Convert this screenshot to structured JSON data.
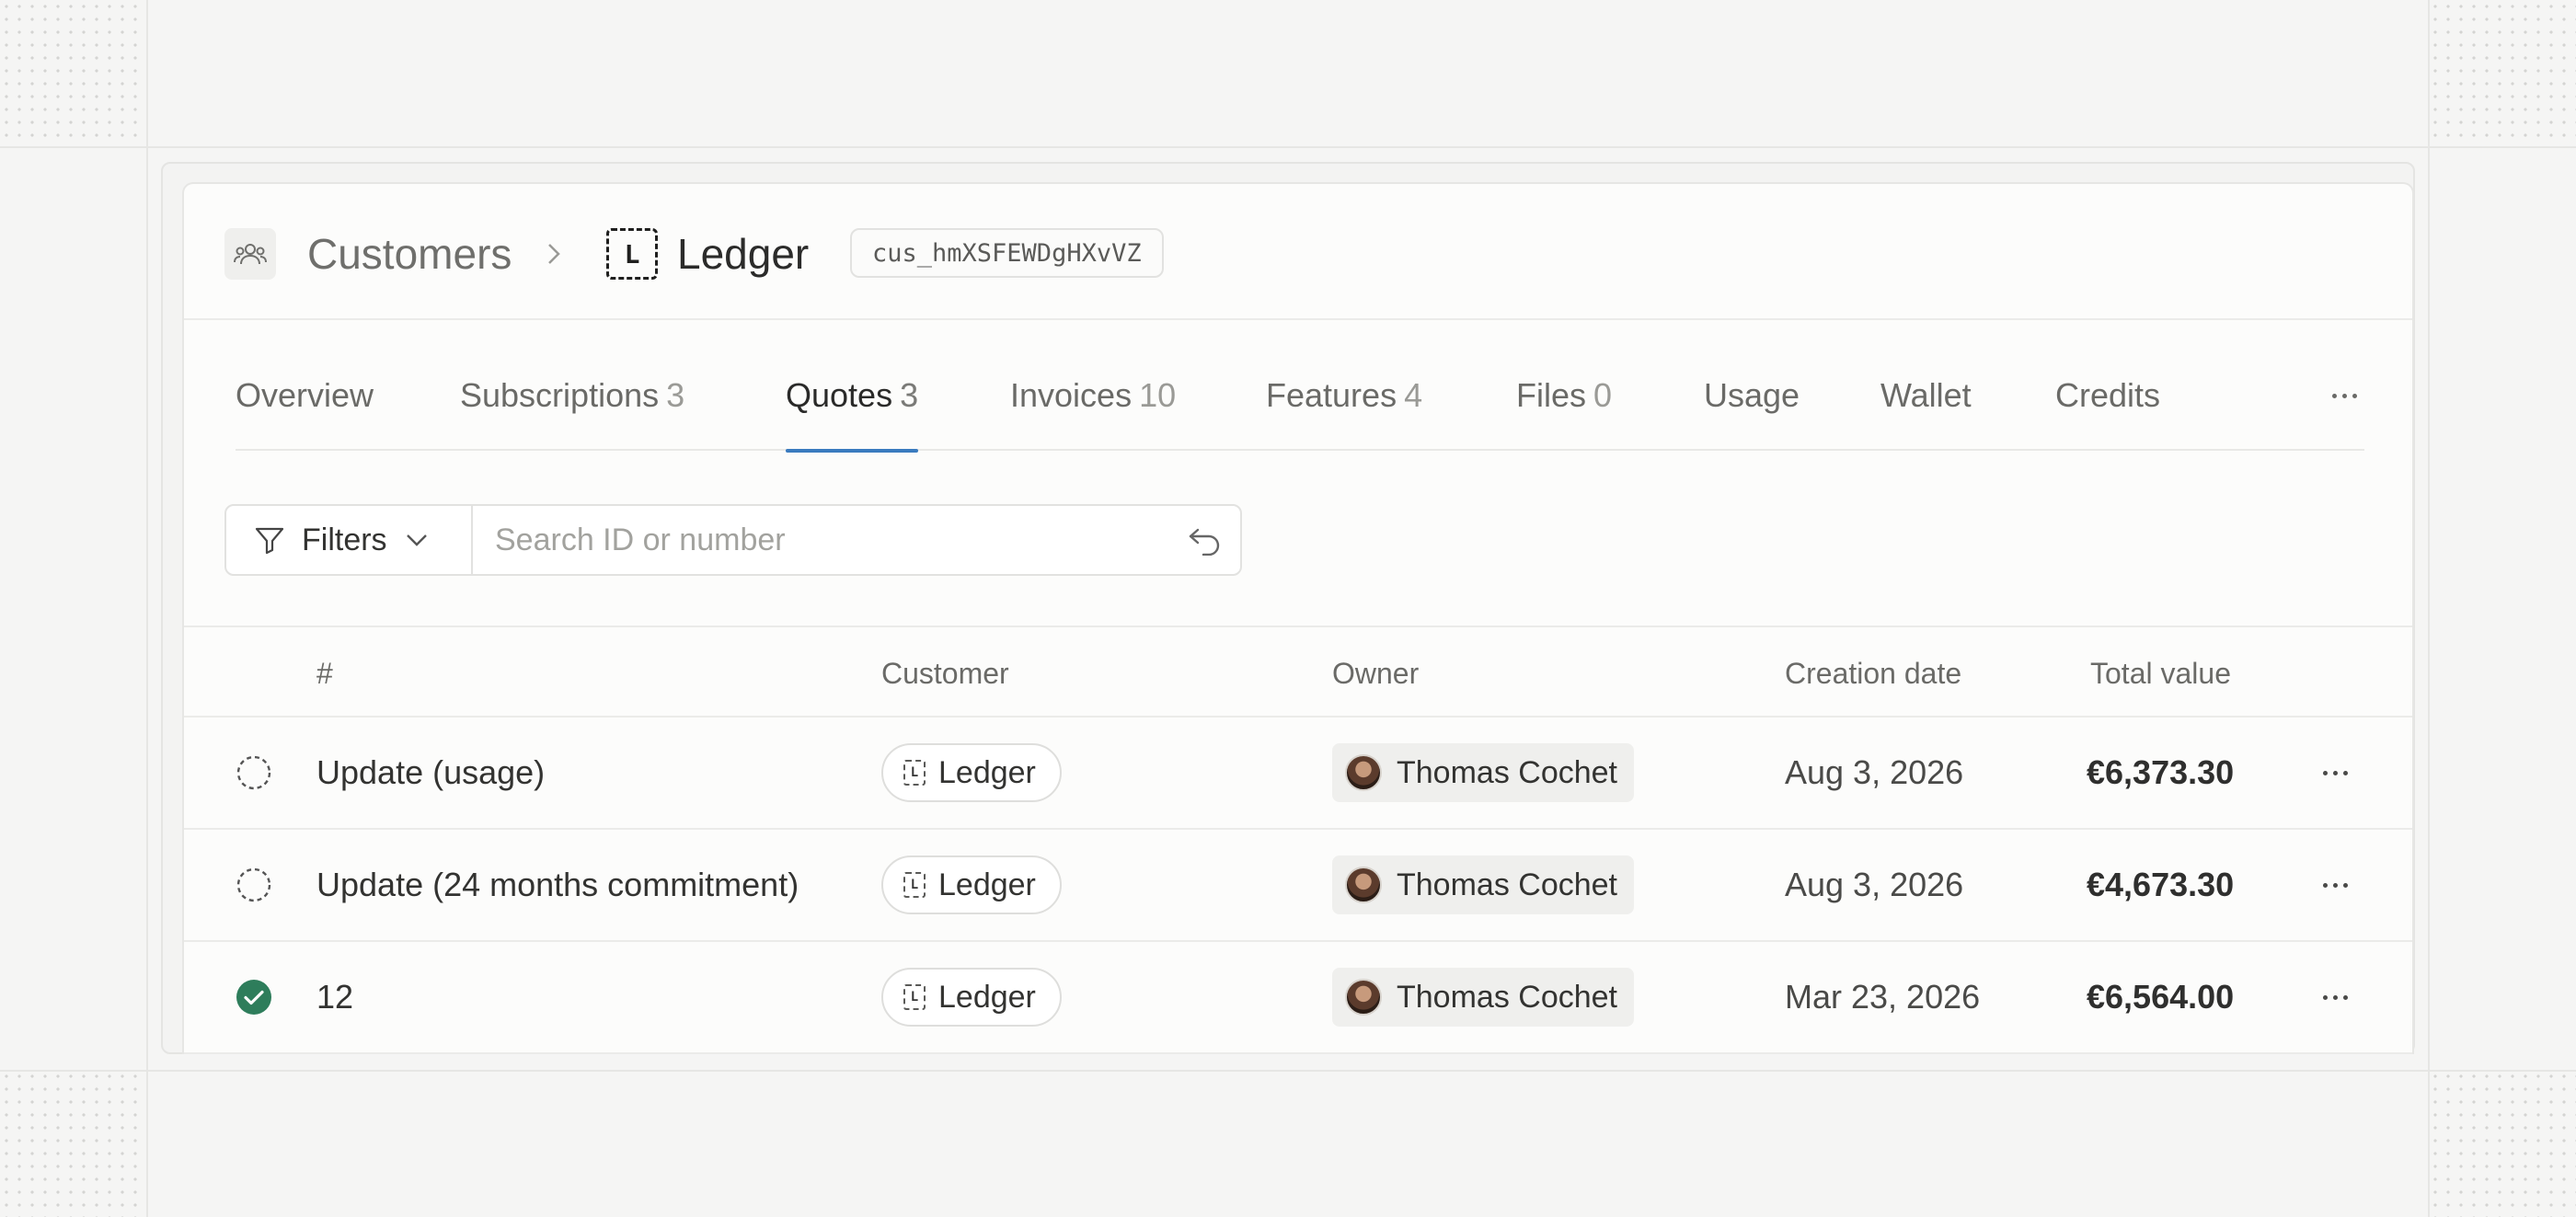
{
  "breadcrumb": {
    "root": "Customers",
    "current": "Ledger",
    "logo_letter": "L",
    "customer_id": "cus_hmXSFEWDgHXvVZ"
  },
  "tabs": [
    {
      "label": "Overview",
      "count": ""
    },
    {
      "label": "Subscriptions",
      "count": "3"
    },
    {
      "label": "Quotes",
      "count": "3",
      "active": true
    },
    {
      "label": "Invoices",
      "count": "10"
    },
    {
      "label": "Features",
      "count": "4"
    },
    {
      "label": "Files",
      "count": "0"
    },
    {
      "label": "Usage",
      "count": ""
    },
    {
      "label": "Wallet",
      "count": ""
    },
    {
      "label": "Credits",
      "count": ""
    }
  ],
  "filters": {
    "label": "Filters",
    "search_placeholder": "Search ID or number"
  },
  "table": {
    "columns": [
      "#",
      "Customer",
      "Owner",
      "Creation date",
      "Total value"
    ],
    "rows": [
      {
        "status": "draft",
        "number": "Update (usage)",
        "customer": "Ledger",
        "owner": "Thomas Cochet",
        "date": "Aug 3, 2026",
        "total": "€6,373.30"
      },
      {
        "status": "draft",
        "number": "Update (24 months commitment)",
        "customer": "Ledger",
        "owner": "Thomas Cochet",
        "date": "Aug 3, 2026",
        "total": "€4,673.30"
      },
      {
        "status": "accepted",
        "number": "12",
        "customer": "Ledger",
        "owner": "Thomas Cochet",
        "date": "Mar 23, 2026",
        "total": "€6,564.00"
      }
    ]
  },
  "colors": {
    "accent": "#3a7bbf",
    "accepted": "#2e7d5b"
  }
}
